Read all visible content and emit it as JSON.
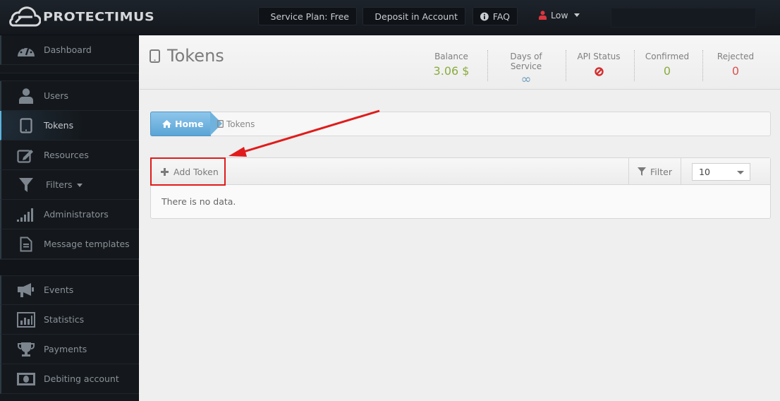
{
  "app": {
    "logo_text": "protectimus"
  },
  "topbar": {
    "service_plan": "Service Plan: Free",
    "deposit": "Deposit in Account",
    "faq": "FAQ",
    "user": "Low"
  },
  "sidebar": {
    "items": [
      {
        "label": "Dashboard",
        "icon": "dashboard-icon"
      },
      {
        "label": "Users",
        "icon": "user-icon"
      },
      {
        "label": "Tokens",
        "icon": "tablet-icon",
        "active": true
      },
      {
        "label": "Resources",
        "icon": "edit-icon"
      },
      {
        "label": "Filters",
        "icon": "filter-icon"
      },
      {
        "label": "Administrators",
        "icon": "signal-icon"
      },
      {
        "label": "Message templates",
        "icon": "document-icon"
      },
      {
        "label": "Events",
        "icon": "bullhorn-icon"
      },
      {
        "label": "Statistics",
        "icon": "bar-chart-icon"
      },
      {
        "label": "Payments",
        "icon": "trophy-icon"
      },
      {
        "label": "Debiting account",
        "icon": "money-icon"
      }
    ]
  },
  "header": {
    "title": "Tokens",
    "stats": [
      {
        "label": "Balance",
        "value": "3.06 $",
        "color": "#8aac3f"
      },
      {
        "label": "Days of Service",
        "value": "∞",
        "color": "#6f9fbd"
      },
      {
        "label": "API Status",
        "value": "disabled",
        "color": "#d62e2e"
      },
      {
        "label": "Confirmed",
        "value": "0",
        "color": "#8aac3f"
      },
      {
        "label": "Rejected",
        "value": "0",
        "color": "#d9534f"
      }
    ]
  },
  "breadcrumb": {
    "home": "Home",
    "current": "Tokens"
  },
  "panel": {
    "add_label": "Add Token",
    "filter_label": "Filter",
    "per_page": "10",
    "empty_text": "There is no data."
  },
  "colors": {
    "accent": "#5aa5d6",
    "annotation": "#e11b1b"
  }
}
